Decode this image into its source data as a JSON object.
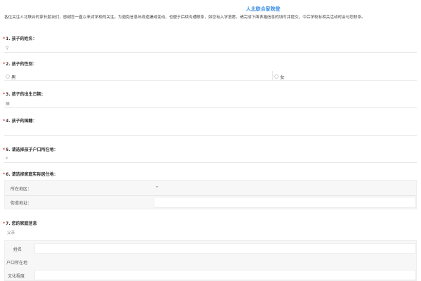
{
  "header": {
    "title": "人北联合家院登",
    "intro": "各位关注人北联合的家长朋友们，感谢您一直以来对学校的关注。为避免信息出现遗漏或变动，也便于后续沟通联系，如您有入学意愿，请完成下面表格信息的填写并提交，今后学校有相关活动时会与您联系。"
  },
  "questions": {
    "q1": {
      "required": "*",
      "label": "1. 孩子的姓名：",
      "icon": "person-icon",
      "icon_glyph": "⚲"
    },
    "q2": {
      "required": "*",
      "label": "2. 孩子的性别：",
      "options": [
        "男",
        "女"
      ]
    },
    "q3": {
      "required": "*",
      "label": "3. 孩子的出生日期：",
      "icon": "calendar-icon",
      "icon_glyph": "▦"
    },
    "q4": {
      "required": "*",
      "label": "4. 孩子的国籍："
    },
    "q5": {
      "required": "*",
      "label": "5. 请选择孩子户口所在地：",
      "icon": "location-icon",
      "icon_glyph": "⌖"
    },
    "q6": {
      "required": "*",
      "label": "6. 请选择家庭实际居住地：",
      "rows": {
        "area_label": "所在地区：",
        "area_icon": "location-icon",
        "area_glyph": "⌖",
        "street_label": "街道地址："
      }
    },
    "q7": {
      "required": "*",
      "label": "7. 您的家庭信息",
      "subtitle": "父亲",
      "rows": {
        "name_label": "姓名",
        "hukou_label": "户口所在地",
        "edu_label": "文化程度"
      }
    }
  }
}
